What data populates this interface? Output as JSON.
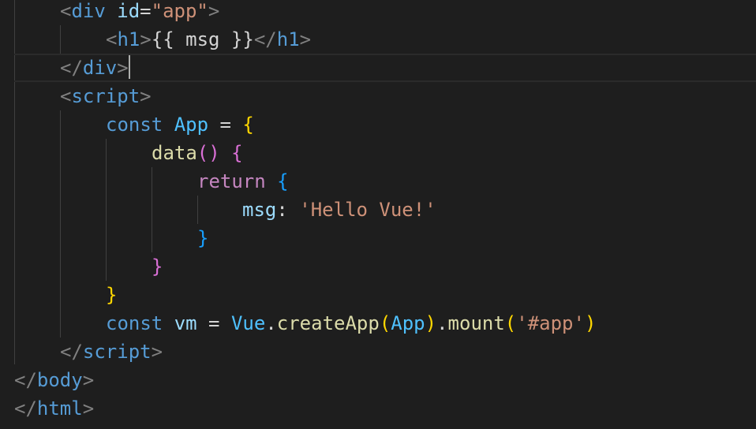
{
  "editor": {
    "lines": [
      {
        "id": "l1",
        "tokens": [
          {
            "t": "<",
            "c": "tk-punct"
          },
          {
            "t": "div",
            "c": "tk-tag"
          },
          {
            "t": " ",
            "c": "tk-text"
          },
          {
            "t": "id",
            "c": "tk-attr"
          },
          {
            "t": "=",
            "c": "tk-op"
          },
          {
            "t": "\"app\"",
            "c": "tk-str"
          },
          {
            "t": ">",
            "c": "tk-punct"
          }
        ]
      },
      {
        "id": "l2",
        "tokens": [
          {
            "t": "<",
            "c": "tk-punct"
          },
          {
            "t": "h1",
            "c": "tk-tag"
          },
          {
            "t": ">",
            "c": "tk-punct"
          },
          {
            "t": "{{ msg }}",
            "c": "tk-text"
          },
          {
            "t": "</",
            "c": "tk-punct"
          },
          {
            "t": "h1",
            "c": "tk-tag"
          },
          {
            "t": ">",
            "c": "tk-punct"
          }
        ]
      },
      {
        "id": "l3",
        "tokens": [
          {
            "t": "</",
            "c": "tk-punct"
          },
          {
            "t": "div",
            "c": "tk-tag"
          },
          {
            "t": ">",
            "c": "tk-punct"
          }
        ]
      },
      {
        "id": "l4",
        "tokens": [
          {
            "t": "<",
            "c": "tk-punct"
          },
          {
            "t": "script",
            "c": "tk-tag"
          },
          {
            "t": ">",
            "c": "tk-punct"
          }
        ]
      },
      {
        "id": "l5",
        "tokens": [
          {
            "t": "const",
            "c": "tk-keyword"
          },
          {
            "t": " ",
            "c": "tk-text"
          },
          {
            "t": "App",
            "c": "tk-class"
          },
          {
            "t": " = ",
            "c": "tk-op"
          },
          {
            "t": "{",
            "c": "tk-br1"
          }
        ]
      },
      {
        "id": "l6",
        "tokens": [
          {
            "t": "data",
            "c": "tk-func"
          },
          {
            "t": "()",
            "c": "tk-br2"
          },
          {
            "t": " ",
            "c": "tk-text"
          },
          {
            "t": "{",
            "c": "tk-br2"
          }
        ]
      },
      {
        "id": "l7",
        "tokens": [
          {
            "t": "return",
            "c": "tk-control"
          },
          {
            "t": " ",
            "c": "tk-text"
          },
          {
            "t": "{",
            "c": "tk-br3"
          }
        ]
      },
      {
        "id": "l8",
        "tokens": [
          {
            "t": "msg",
            "c": "tk-var"
          },
          {
            "t": ": ",
            "c": "tk-op"
          },
          {
            "t": "'Hello Vue!'",
            "c": "tk-str"
          }
        ]
      },
      {
        "id": "l9",
        "tokens": [
          {
            "t": "}",
            "c": "tk-br3"
          }
        ]
      },
      {
        "id": "l10",
        "tokens": [
          {
            "t": "}",
            "c": "tk-br2"
          }
        ]
      },
      {
        "id": "l11",
        "tokens": [
          {
            "t": "}",
            "c": "tk-br1"
          }
        ]
      },
      {
        "id": "l12",
        "tokens": [
          {
            "t": "const",
            "c": "tk-keyword"
          },
          {
            "t": " ",
            "c": "tk-text"
          },
          {
            "t": "vm",
            "c": "tk-var"
          },
          {
            "t": " = ",
            "c": "tk-op"
          },
          {
            "t": "Vue",
            "c": "tk-class"
          },
          {
            "t": ".",
            "c": "tk-op"
          },
          {
            "t": "createApp",
            "c": "tk-func"
          },
          {
            "t": "(",
            "c": "tk-br1"
          },
          {
            "t": "App",
            "c": "tk-class"
          },
          {
            "t": ")",
            "c": "tk-br1"
          },
          {
            "t": ".",
            "c": "tk-op"
          },
          {
            "t": "mount",
            "c": "tk-func"
          },
          {
            "t": "(",
            "c": "tk-br1"
          },
          {
            "t": "'#app'",
            "c": "tk-str"
          },
          {
            "t": ")",
            "c": "tk-br1"
          }
        ]
      },
      {
        "id": "l13",
        "tokens": [
          {
            "t": "</",
            "c": "tk-punct"
          },
          {
            "t": "script",
            "c": "tk-tag"
          },
          {
            "t": ">",
            "c": "tk-punct"
          }
        ]
      },
      {
        "id": "l14",
        "tokens": [
          {
            "t": "</",
            "c": "tk-punct"
          },
          {
            "t": "body",
            "c": "tk-tag"
          },
          {
            "t": ">",
            "c": "tk-punct"
          }
        ]
      },
      {
        "id": "l15",
        "tokens": [
          {
            "t": "</",
            "c": "tk-punct"
          },
          {
            "t": "html",
            "c": "tk-tag"
          },
          {
            "t": ">",
            "c": "tk-punct"
          }
        ]
      }
    ]
  }
}
